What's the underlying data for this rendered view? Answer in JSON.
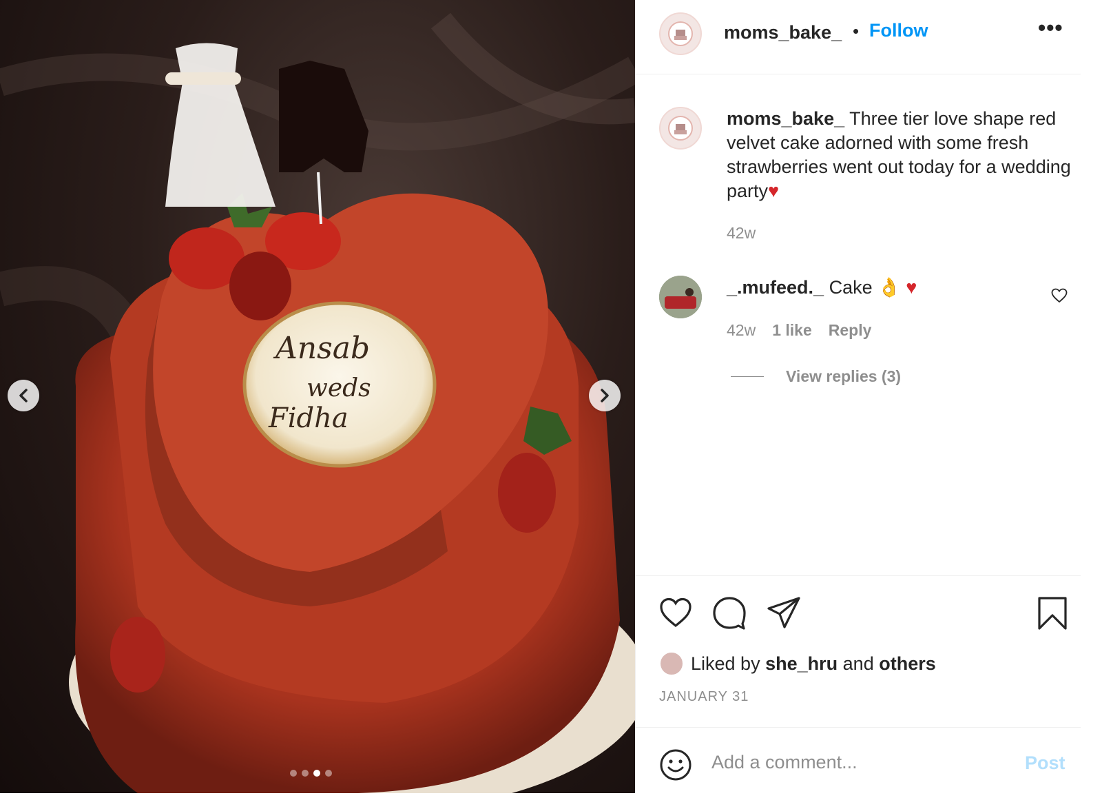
{
  "post": {
    "author": "moms_bake_",
    "follow_label": "Follow",
    "separator": "•",
    "more_label": "•••",
    "image": {
      "plaque_line1": "Ansab",
      "plaque_line2": "weds",
      "plaque_line3": "Fidha",
      "carousel_total": 4,
      "carousel_active": 3
    },
    "caption": {
      "username": "moms_bake_",
      "text": "Three tier love shape red velvet cake adorned with some fresh strawberries went out today for a wedding party",
      "emoji": "♥",
      "time": "42w"
    },
    "comments": [
      {
        "username": "_.mufeed._",
        "text": "Cake",
        "emoji": "👌 ♥",
        "time": "42w",
        "likes": "1 like",
        "reply_label": "Reply",
        "view_replies": "View replies (3)"
      }
    ],
    "liked_by": {
      "prefix": "Liked by",
      "user": "she_hru",
      "joiner": "and",
      "others": "others"
    },
    "date": "JANUARY 31",
    "comment_box": {
      "placeholder": "Add a comment...",
      "post_label": "Post"
    }
  },
  "icons": {
    "prev": "chevron-left-icon",
    "next": "chevron-right-icon",
    "like": "heart-outline-icon",
    "comment": "speech-bubble-icon",
    "share": "paper-plane-icon",
    "save": "bookmark-icon",
    "emoji": "smiley-icon"
  },
  "colors": {
    "accent": "#0095f6",
    "post_disabled": "#b2dffc",
    "muted": "#8e8e8e",
    "text": "#262626"
  }
}
